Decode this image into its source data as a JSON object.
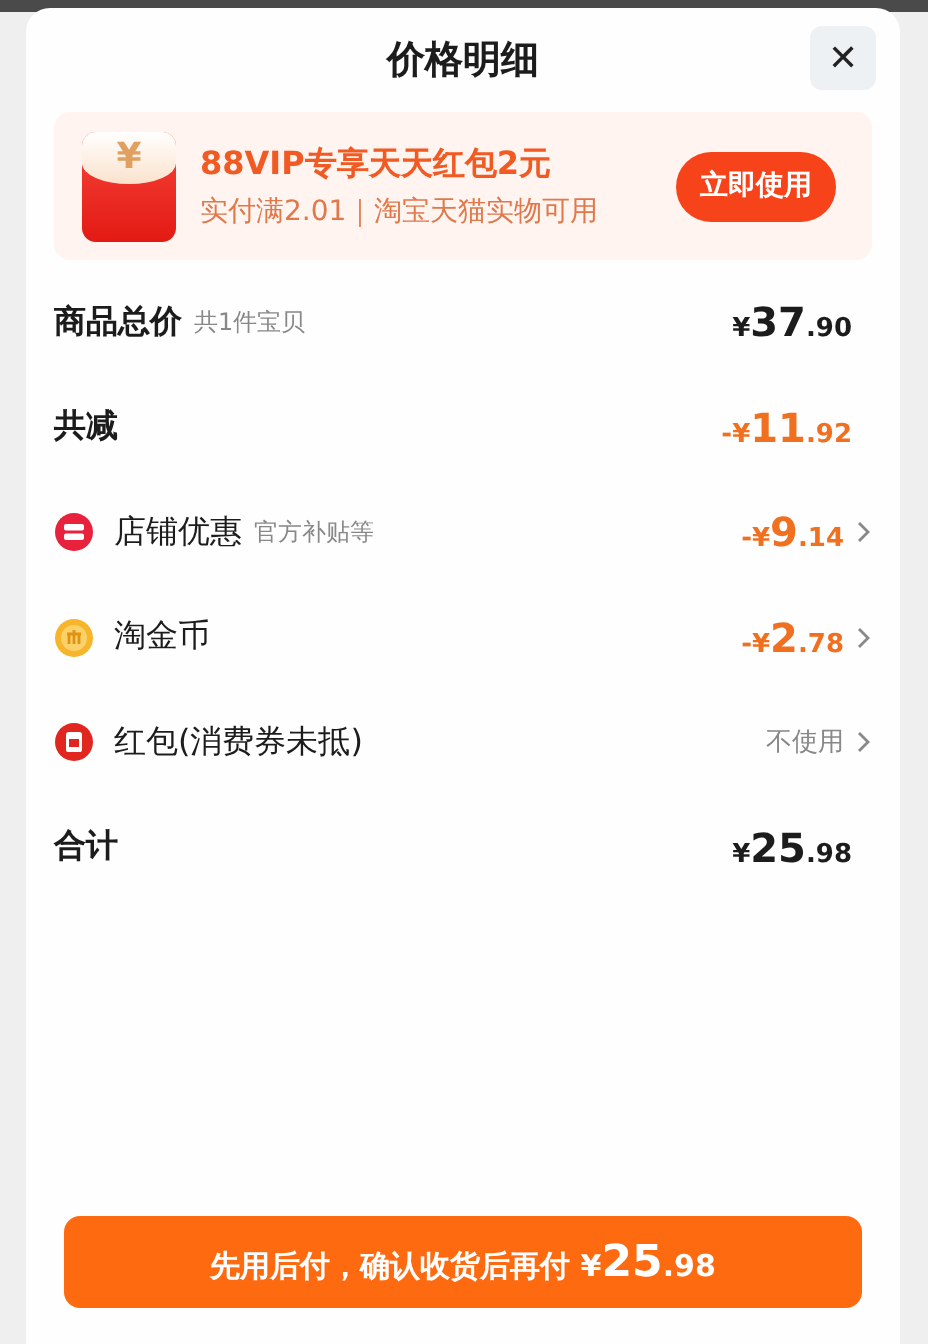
{
  "sheet": {
    "title": "价格明细",
    "close": "✕"
  },
  "promo": {
    "headline": "88VIP专享天天红包2元",
    "condition": "实付满2.01｜淘宝天猫实物可用",
    "icon_glyph": "¥",
    "action": "立即使用"
  },
  "rows": [
    {
      "kind": "subtotal",
      "label": "商品总价",
      "note": "共1件宝贝",
      "value": "¥37.90"
    },
    {
      "kind": "reduction",
      "label": "共减",
      "value": "-¥11.92"
    },
    {
      "kind": "shop",
      "label": "店铺优惠",
      "note": "官方补贴等",
      "value": "-¥9.14"
    },
    {
      "kind": "coin",
      "label": "淘金币",
      "value": "-¥2.78"
    },
    {
      "kind": "packet",
      "label": "红包(消费券未抵)",
      "value": "不使用"
    },
    {
      "kind": "total",
      "label": "合计",
      "value": "¥25.98"
    }
  ],
  "pay_button": {
    "text": "先用后付，确认收货后再付",
    "amount": "¥25.98"
  }
}
